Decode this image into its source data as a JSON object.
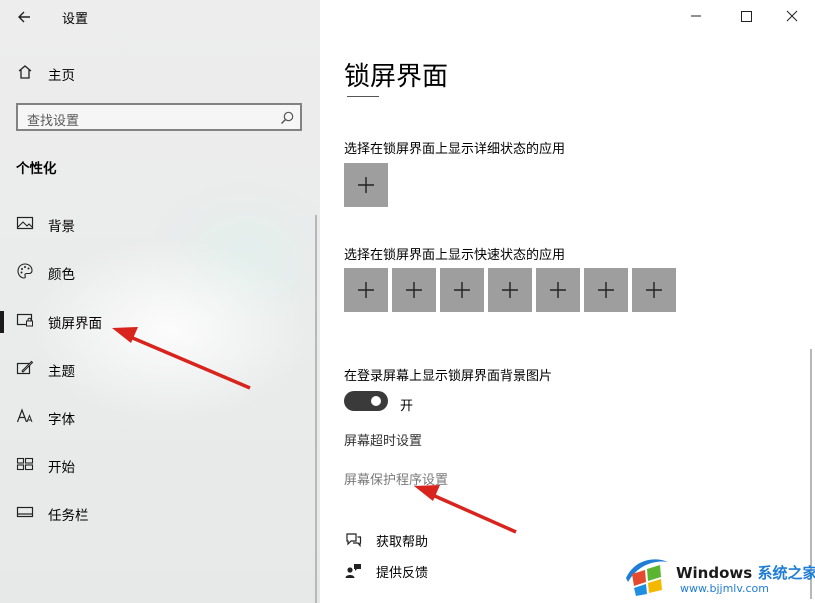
{
  "window": {
    "title": "设置",
    "controls": [
      "minimize-icon",
      "maximize-icon",
      "close-icon"
    ]
  },
  "sidebar": {
    "home_label": "主页",
    "search": {
      "placeholder": "查找设置"
    },
    "section_title": "个性化",
    "items": [
      {
        "label": "背景",
        "icon": "picture-icon"
      },
      {
        "label": "颜色",
        "icon": "palette-icon"
      },
      {
        "label": "锁屏界面",
        "icon": "lock-screen-icon",
        "selected": true
      },
      {
        "label": "主题",
        "icon": "theme-brush-icon"
      },
      {
        "label": "字体",
        "icon": "font-icon"
      },
      {
        "label": "开始",
        "icon": "start-grid-icon"
      },
      {
        "label": "任务栏",
        "icon": "taskbar-icon"
      }
    ]
  },
  "main": {
    "title": "锁屏界面",
    "detailed_status_label": "选择在锁屏界面上显示详细状态的应用",
    "quick_status_label": "选择在锁屏界面上显示快速状态的应用",
    "signin_bg_label": "在登录屏幕上显示锁屏界面背景图片",
    "toggle_state": "开",
    "toggle_on": true,
    "timeout_link": "屏幕超时设置",
    "screensaver_link": "屏幕保护程序设置",
    "help_link": "获取帮助",
    "feedback_link": "提供反馈"
  },
  "watermark": {
    "brand": "Windows",
    "brand_suffix": "系统之家",
    "url": "www.bjjmlv.com"
  },
  "colors": {
    "tile": "#9e9e9e",
    "toggle_on": "#3a3a3a",
    "annotation_arrow": "#d9231d",
    "watermark_blue": "#1f7dd6"
  }
}
